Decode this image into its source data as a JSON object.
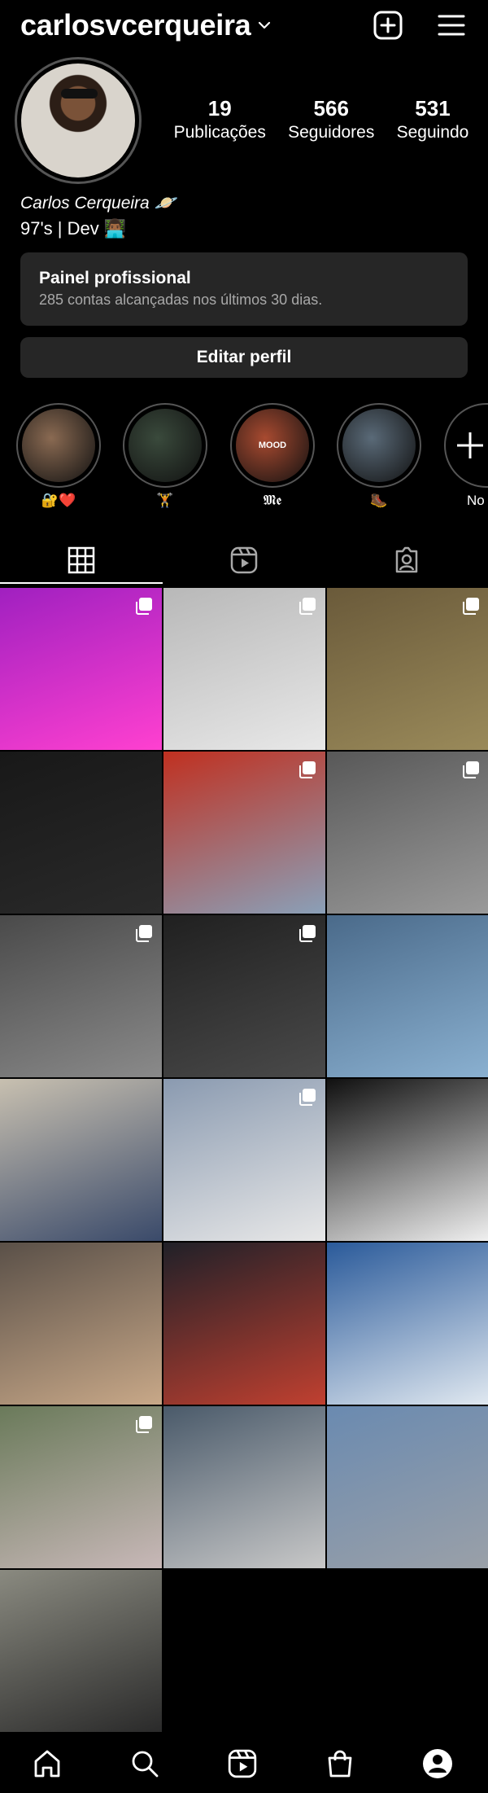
{
  "header": {
    "username": "carlosvcerqueira"
  },
  "profile": {
    "stats": [
      {
        "value": "19",
        "label": "Publicações"
      },
      {
        "value": "566",
        "label": "Seguidores"
      },
      {
        "value": "531",
        "label": "Seguindo"
      }
    ],
    "fullname": "Carlos Cerqueira 🪐",
    "bio": "97's | Dev 👨🏾‍💻"
  },
  "professional_panel": {
    "title": "Painel profissional",
    "subtitle": "285 contas alcançadas nos últimos 30 dias."
  },
  "edit_profile_label": "Editar perfil",
  "highlights": [
    {
      "label": "🔐❤️",
      "color": "#8a6a52"
    },
    {
      "label": "🏋",
      "color": "#3a4a3c"
    },
    {
      "label": "𝕸𝖊",
      "color": "#a84a30",
      "overlay_text": "MOOD"
    },
    {
      "label": "🥾",
      "color": "#5a6a78"
    },
    {
      "label": "No",
      "color": "#111111"
    }
  ],
  "posts": [
    {
      "colors": [
        "#a020c0",
        "#ff40d0"
      ],
      "multi": true
    },
    {
      "colors": [
        "#b8b8b8",
        "#e8e8e8"
      ],
      "multi": true
    },
    {
      "colors": [
        "#6a5a3a",
        "#9a8a5a"
      ],
      "multi": true
    },
    {
      "colors": [
        "#181818",
        "#2a2a2a"
      ],
      "multi": false
    },
    {
      "colors": [
        "#c03020",
        "#8aa0b8"
      ],
      "multi": true
    },
    {
      "colors": [
        "#585858",
        "#9a9a9a"
      ],
      "multi": true
    },
    {
      "colors": [
        "#4a4a4a",
        "#8a8a8a"
      ],
      "multi": true
    },
    {
      "colors": [
        "#202020",
        "#4a4a4a"
      ],
      "multi": true
    },
    {
      "colors": [
        "#4a6a8a",
        "#8ab0d0"
      ],
      "multi": false
    },
    {
      "colors": [
        "#c8c0b0",
        "#3a4a6a"
      ],
      "multi": false
    },
    {
      "colors": [
        "#8a9ab0",
        "#e8e8e8"
      ],
      "multi": true
    },
    {
      "colors": [
        "#101010",
        "#f0f0f0"
      ],
      "multi": false
    },
    {
      "colors": [
        "#5a5048",
        "#c8a888"
      ],
      "multi": false
    },
    {
      "colors": [
        "#202028",
        "#c04030"
      ],
      "multi": false
    },
    {
      "colors": [
        "#2a5a9a",
        "#e0e8f0"
      ],
      "multi": false
    },
    {
      "colors": [
        "#6a7a5a",
        "#c8b8b8"
      ],
      "multi": true
    },
    {
      "colors": [
        "#4a5a6a",
        "#c8c8c8"
      ],
      "multi": false
    },
    {
      "colors": [
        "#6a8ab0",
        "#9aa0a8"
      ],
      "multi": false
    },
    {
      "colors": [
        "#8a8a80",
        "#2a2a2a"
      ],
      "multi": false
    }
  ]
}
